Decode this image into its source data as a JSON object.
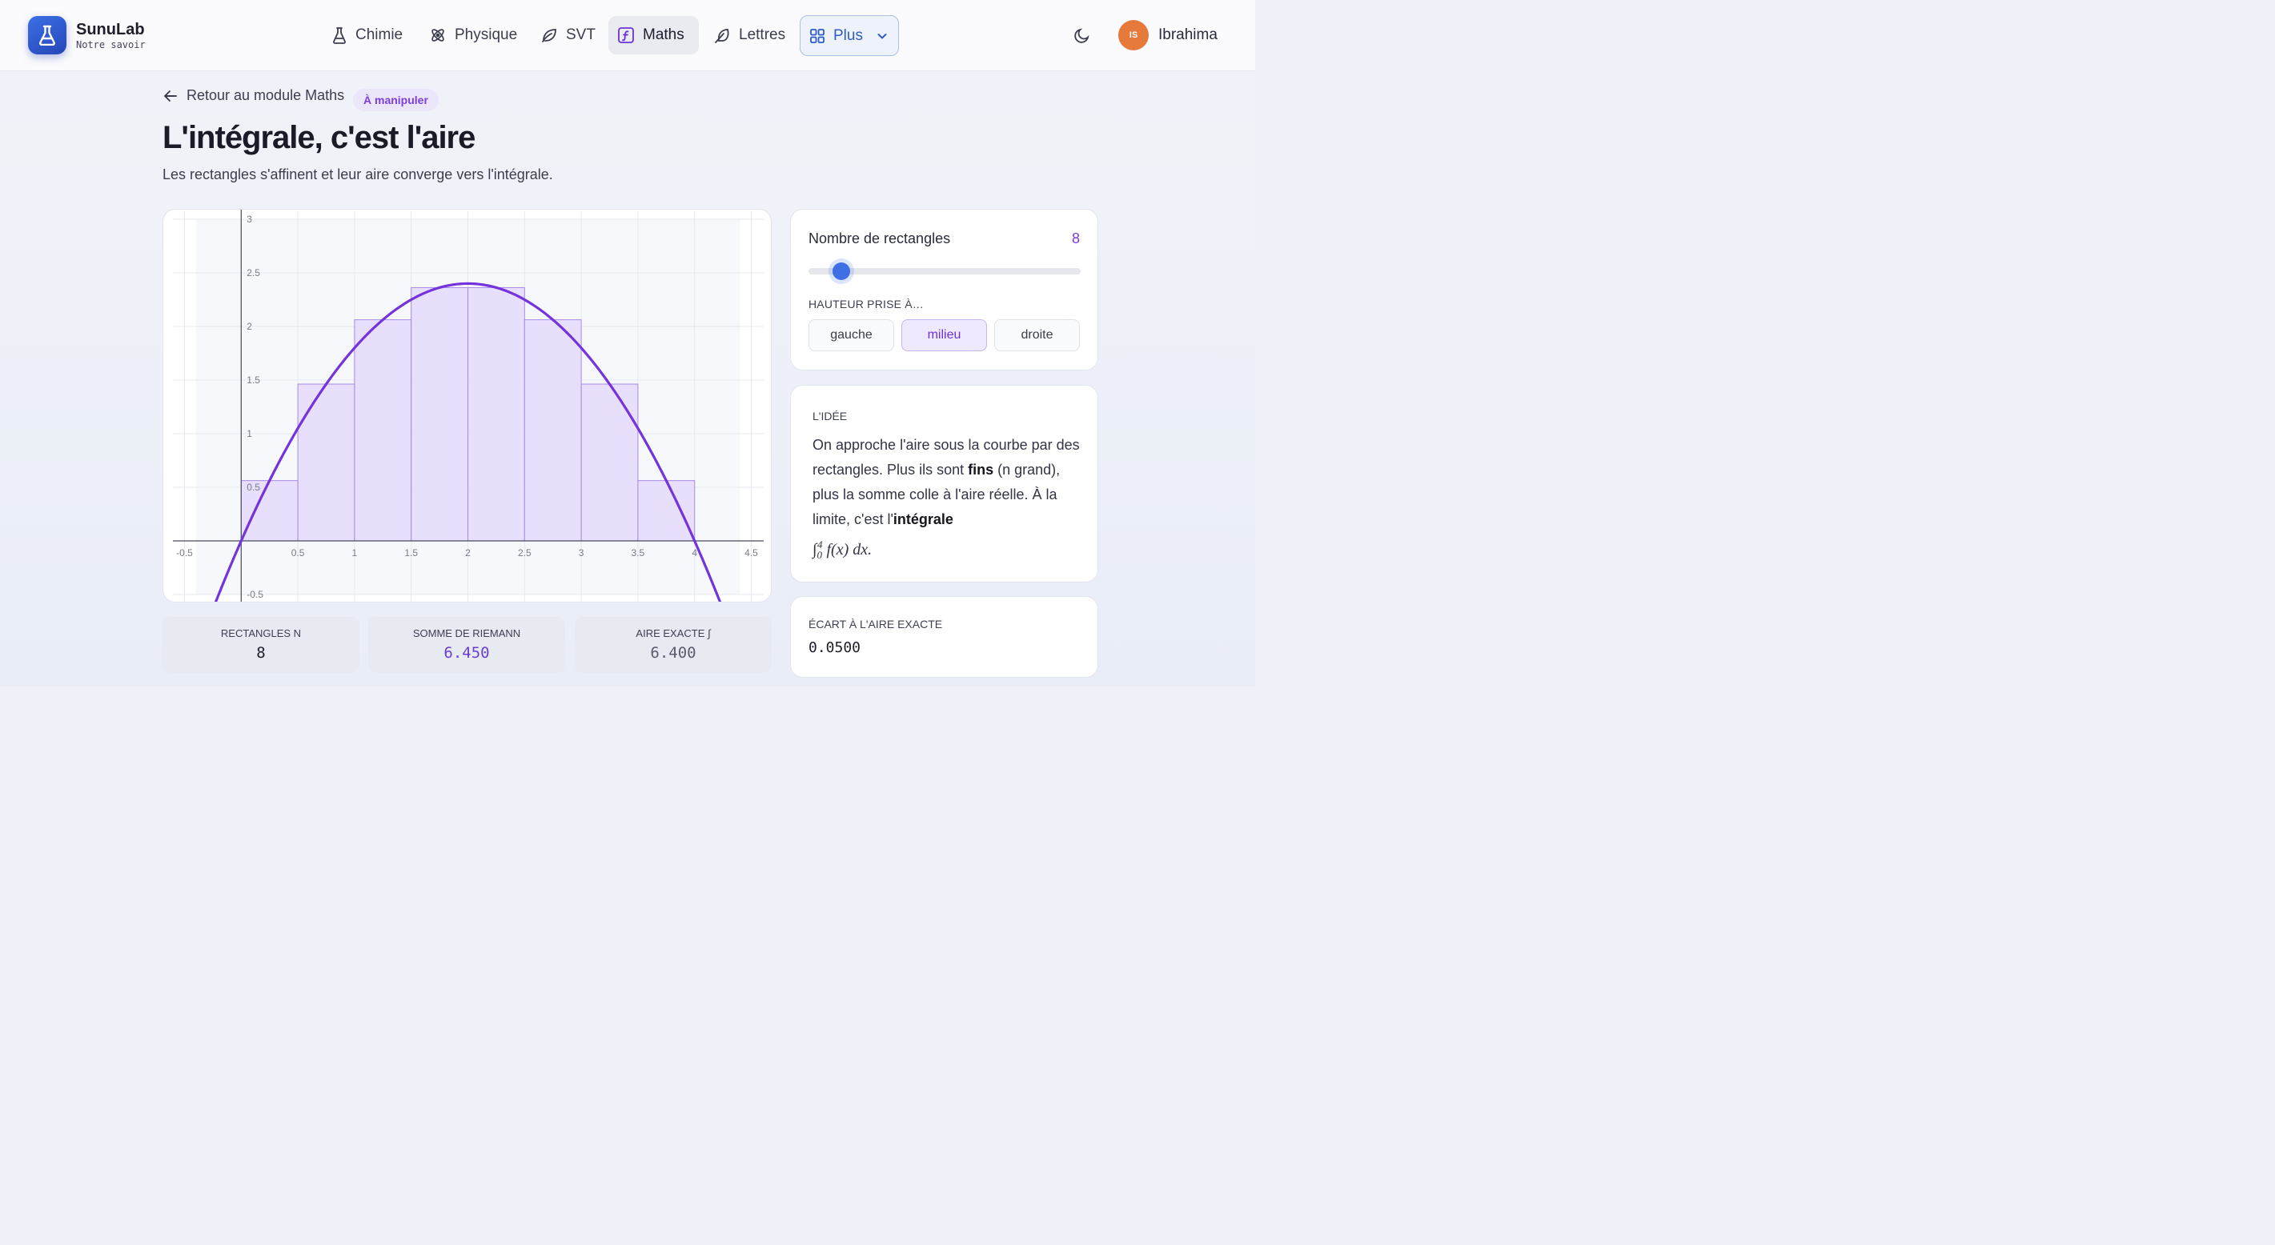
{
  "nav": {
    "brand": "SunuLab",
    "tagline": "Notre savoir",
    "items": [
      {
        "label": "Chimie",
        "icon": "flask-icon"
      },
      {
        "label": "Physique",
        "icon": "atom-icon"
      },
      {
        "label": "SVT",
        "icon": "leaf-icon"
      },
      {
        "label": "Maths",
        "icon": "function-icon",
        "active": true
      },
      {
        "label": "Lettres",
        "icon": "feather-icon"
      },
      {
        "label": "Plus",
        "icon": "grid-icon"
      }
    ],
    "user": {
      "initials": "IS",
      "name": "Ibrahima"
    }
  },
  "header": {
    "back_label": "Retour au module Maths",
    "badge": "À manipuler",
    "title": "L'intégrale, c'est l'aire",
    "subtitle": "Les rectangles s'affinent et leur aire converge vers l'intégrale."
  },
  "chart_data": {
    "type": "bar",
    "description_series": "f(x) = -0.6x^2 + 2.4x on [0,4], midpoint Riemann sum",
    "xlim": [
      -0.5,
      4.5
    ],
    "ylim": [
      -0.5,
      3
    ],
    "x_ticks": [
      "-0.5",
      "0.5",
      "1",
      "1.5",
      "2",
      "2.5",
      "3",
      "3.5",
      "4",
      "4.5"
    ],
    "y_ticks": [
      "-0.5",
      "0.5",
      "1",
      "1.5",
      "2",
      "2.5",
      "3"
    ],
    "rect_left_edges": [
      0,
      0.5,
      1,
      1.5,
      2,
      2.5,
      3,
      3.5
    ],
    "rect_width": 0.5,
    "values": [
      0.5625,
      1.4625,
      2.0625,
      2.3625,
      2.3625,
      2.0625,
      1.4625,
      0.5625
    ],
    "curve": {
      "a": -0.6,
      "b": 2.4,
      "c": 0
    },
    "colors": {
      "curve": "#7434db",
      "rect_fill": "#e4dafb",
      "rect_stroke": "#a98ae8"
    }
  },
  "stats": [
    {
      "label": "RECTANGLES N",
      "value": "8",
      "color": "#1e1d2a"
    },
    {
      "label": "SOMME DE RIEMANN",
      "value": "6.450",
      "color": "#6a3fd0"
    },
    {
      "label": "AIRE EXACTE ∫",
      "value": "6.400",
      "color": "#5a5c6c"
    }
  ],
  "controls": {
    "count_label": "Nombre de rectangles",
    "count_value": "8",
    "slider_fraction": 0.12,
    "height_label": "HAUTEUR PRISE À…",
    "options": [
      "gauche",
      "milieu",
      "droite"
    ],
    "selected": "milieu"
  },
  "idea": {
    "heading": "L'IDÉE",
    "p1": "On approche l'aire sous la courbe par des rectangles. Plus ils sont ",
    "bold1": "fins",
    "p2": " (n grand), plus la somme colle à l'aire réelle. À la limite, c'est l'",
    "bold2": "intégrale",
    "math_lower": "0",
    "math_upper": "4",
    "math_tail": "f(x) dx."
  },
  "gap": {
    "heading": "ÉCART À L'AIRE EXACTE",
    "value": "0.0500"
  }
}
